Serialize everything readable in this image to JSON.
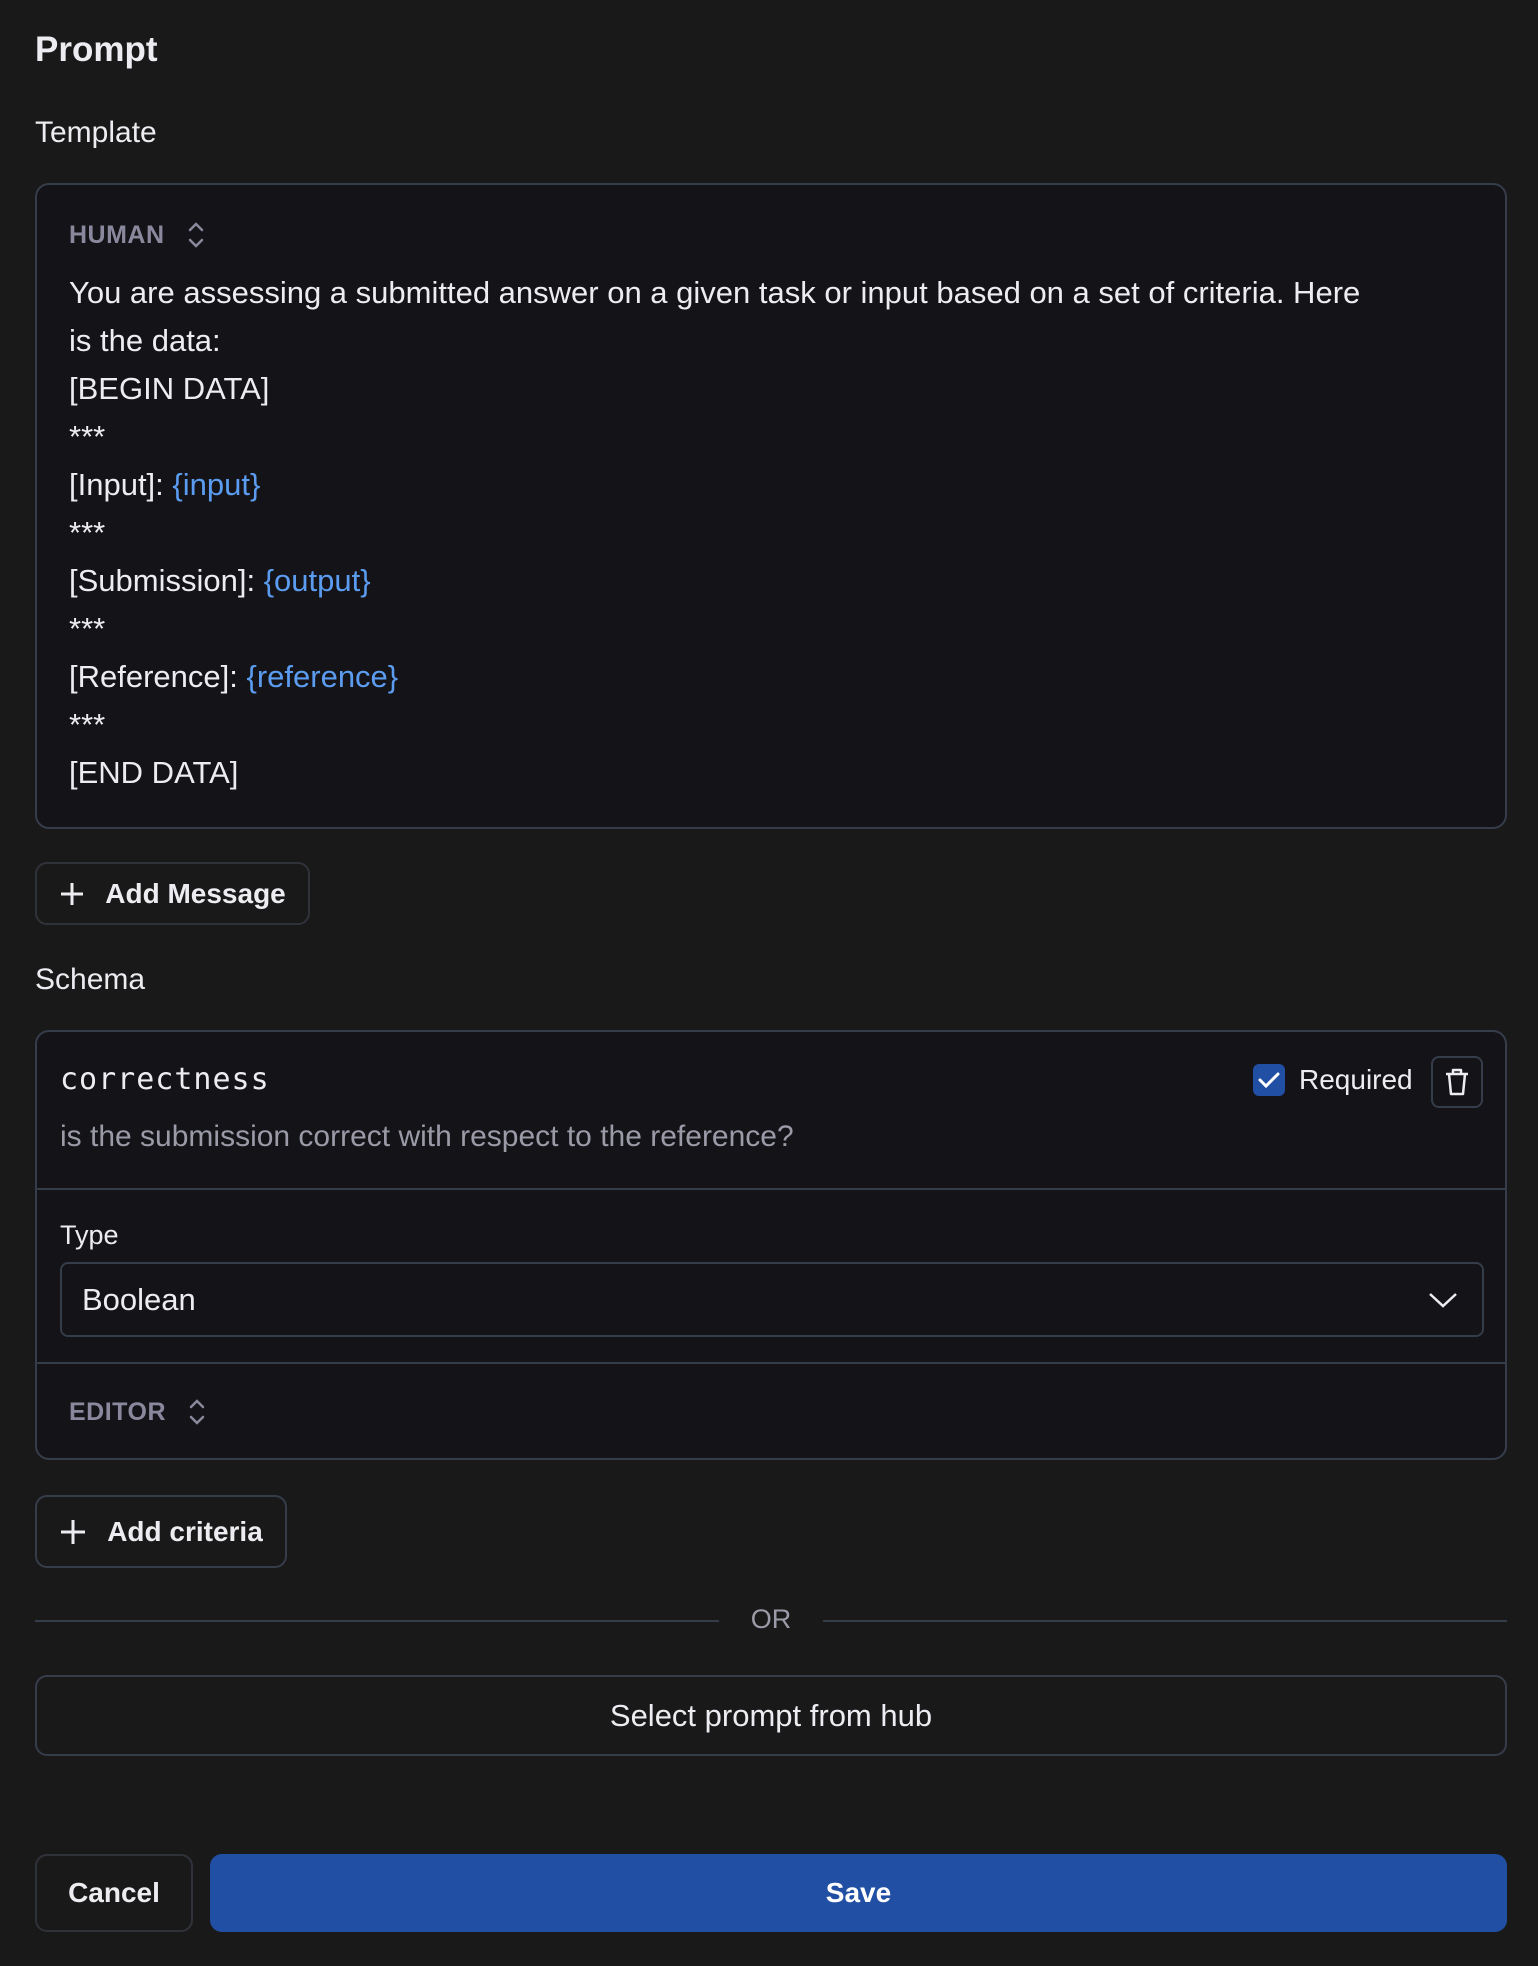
{
  "header": {
    "title": "Prompt"
  },
  "template": {
    "label": "Template",
    "role": "HUMAN",
    "role_icon": "chevron-up-down-icon",
    "lines": [
      [
        {
          "t": "You are assessing a submitted answer on a given task or input based on a set of criteria. Here"
        }
      ],
      [
        {
          "t": "is the data:"
        }
      ],
      [
        {
          "t": "[BEGIN DATA]"
        }
      ],
      [
        {
          "t": "***"
        }
      ],
      [
        {
          "t": "[Input]: "
        },
        {
          "t": "{input}",
          "var": true
        }
      ],
      [
        {
          "t": "***"
        }
      ],
      [
        {
          "t": "[Submission]: "
        },
        {
          "t": "{output}",
          "var": true
        }
      ],
      [
        {
          "t": "***"
        }
      ],
      [
        {
          "t": "[Reference]: "
        },
        {
          "t": "{reference}",
          "var": true
        }
      ],
      [
        {
          "t": "***"
        }
      ],
      [
        {
          "t": "[END DATA]"
        }
      ]
    ],
    "add_message_label": "Add Message"
  },
  "schema": {
    "label": "Schema",
    "criterion": {
      "name": "correctness",
      "description": "is the submission correct with respect to the reference?",
      "required_label": "Required",
      "required": true,
      "type_label": "Type",
      "type_value": "Boolean",
      "editor_label": "EDITOR"
    },
    "add_criteria_label": "Add criteria"
  },
  "or_label": "OR",
  "hub_button_label": "Select prompt from hub",
  "footer": {
    "cancel_label": "Cancel",
    "save_label": "Save"
  },
  "colors": {
    "accent": "#214fa3",
    "variable": "#5b9cf0",
    "background": "#19191a",
    "panel": "#131318"
  }
}
